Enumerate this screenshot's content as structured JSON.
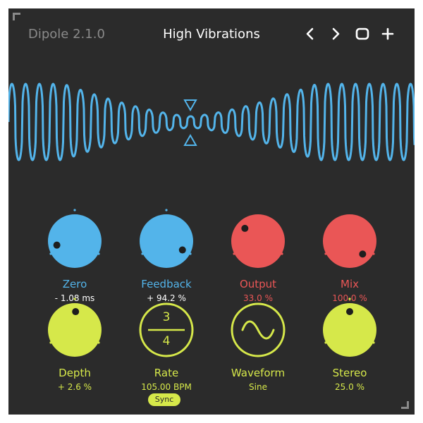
{
  "header": {
    "version": "Dipole 2.1.0",
    "preset": "High Vibrations"
  },
  "colors": {
    "background": "#2b2b2b",
    "blue": "#53b4ea",
    "red": "#ea5656",
    "yellow": "#d6e84a",
    "wave": "#53b4ea"
  },
  "icons": {
    "prev": "chevron-left-icon",
    "next": "chevron-right-icon",
    "window": "rounded-square-icon",
    "add": "plus-icon",
    "marker": "triangle-markers-icon"
  },
  "controls": {
    "zero": {
      "label": "Zero",
      "value": "- 1.08 ms",
      "color": "#53b4ea",
      "level": 0.12
    },
    "feedback": {
      "label": "Feedback",
      "value": "+ 94.2 %",
      "color": "#53b4ea",
      "level": 0.94
    },
    "output": {
      "label": "Output",
      "value": "33.0 %",
      "color": "#ea5656",
      "level": 0.33
    },
    "mix": {
      "label": "Mix",
      "value": "100.0 %",
      "color": "#ea5656",
      "level": 1.0
    },
    "depth": {
      "label": "Depth",
      "value": "+ 2.6 %",
      "color": "#d6e84a",
      "level": 0.51
    },
    "rate": {
      "label": "Rate",
      "value": "105.00 BPM",
      "color": "#d6e84a",
      "numerator": "3",
      "denominator": "4"
    },
    "waveform": {
      "label": "Waveform",
      "value": "Sine",
      "color": "#d6e84a"
    },
    "stereo": {
      "label": "Stereo",
      "value": "25.0 %",
      "color": "#d6e84a",
      "level": 0.5
    }
  },
  "sync_label": "Sync"
}
